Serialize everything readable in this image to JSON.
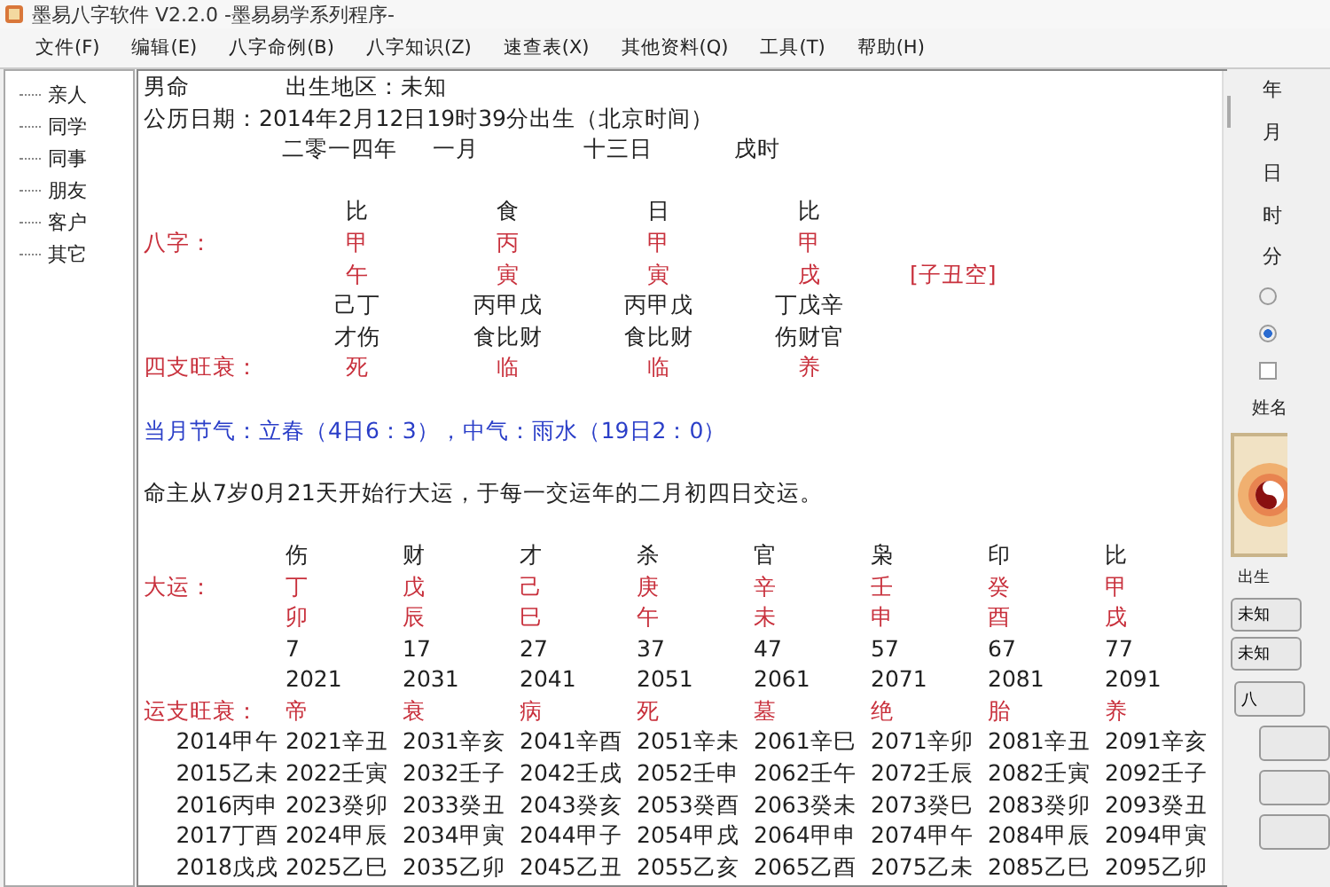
{
  "window": {
    "title": "墨易八字软件 V2.2.0  -墨易易学系列程序-"
  },
  "menu": [
    "文件(F)",
    "编辑(E)",
    "八字命例(B)",
    "八字知识(Z)",
    "速查表(X)",
    "其他资料(Q)",
    "工具(T)",
    "帮助(H)"
  ],
  "sidebar": {
    "items": [
      {
        "label": "亲人",
        "selected": false
      },
      {
        "label": "同学",
        "selected": false
      },
      {
        "label": "同事",
        "selected": false
      },
      {
        "label": "朋友",
        "selected": false
      },
      {
        "label": "客户",
        "selected": false
      },
      {
        "label": "其它",
        "selected": false
      }
    ]
  },
  "chart": {
    "gender": "男命",
    "region": "出生地区：未知",
    "solar_date": "公历日期：2014年2月12日19时39分出生（北京时间）",
    "lunar": [
      "二零一四年",
      "一月",
      "十三日",
      "戌时"
    ],
    "bazi_label": "八字：",
    "state_label": "四支旺衰：",
    "kongwang": "[子丑空]",
    "pillars": [
      {
        "god": "比",
        "stem": "甲",
        "branch": "午",
        "hidden": "己丁",
        "hidden_gods": "才伤",
        "state": "死"
      },
      {
        "god": "食",
        "stem": "丙",
        "branch": "寅",
        "hidden": "丙甲戊",
        "hidden_gods": "食比财",
        "state": "临"
      },
      {
        "god": "日",
        "stem": "甲",
        "branch": "寅",
        "hidden": "丙甲戊",
        "hidden_gods": "食比财",
        "state": "临"
      },
      {
        "god": "比",
        "stem": "甲",
        "branch": "戌",
        "hidden": "丁戊辛",
        "hidden_gods": "伤财官",
        "state": "养"
      }
    ],
    "jieqi": "当月节气：立春（4日6：3），中气：雨水（19日2：0）",
    "start": "命主从7岁0月21天开始行大运，于每一交运年的二月初四日交运。",
    "dayun_label": "大运：",
    "dayun_state_label": "运支旺衰：",
    "dayun": [
      {
        "god": "伤",
        "stem": "丁",
        "branch": "卯",
        "age": "7",
        "year": "2021",
        "state": "帝"
      },
      {
        "god": "财",
        "stem": "戊",
        "branch": "辰",
        "age": "17",
        "year": "2031",
        "state": "衰"
      },
      {
        "god": "才",
        "stem": "己",
        "branch": "巳",
        "age": "27",
        "year": "2041",
        "state": "病"
      },
      {
        "god": "杀",
        "stem": "庚",
        "branch": "午",
        "age": "37",
        "year": "2051",
        "state": "死"
      },
      {
        "god": "官",
        "stem": "辛",
        "branch": "未",
        "age": "47",
        "year": "2061",
        "state": "墓"
      },
      {
        "god": "枭",
        "stem": "壬",
        "branch": "申",
        "age": "57",
        "year": "2071",
        "state": "绝"
      },
      {
        "god": "印",
        "stem": "癸",
        "branch": "酉",
        "age": "67",
        "year": "2081",
        "state": "胎"
      },
      {
        "god": "比",
        "stem": "甲",
        "branch": "戌",
        "age": "77",
        "year": "2091",
        "state": "养"
      }
    ],
    "liunian": [
      [
        "2014甲午",
        "2021辛丑",
        "2031辛亥",
        "2041辛酉",
        "2051辛未",
        "2061辛巳",
        "2071辛卯",
        "2081辛丑",
        "2091辛亥"
      ],
      [
        "2015乙未",
        "2022壬寅",
        "2032壬子",
        "2042壬戌",
        "2052壬申",
        "2062壬午",
        "2072壬辰",
        "2082壬寅",
        "2092壬子"
      ],
      [
        "2016丙申",
        "2023癸卯",
        "2033癸丑",
        "2043癸亥",
        "2053癸酉",
        "2063癸未",
        "2073癸巳",
        "2083癸卯",
        "2093癸丑"
      ],
      [
        "2017丁酉",
        "2024甲辰",
        "2034甲寅",
        "2044甲子",
        "2054甲戌",
        "2064甲申",
        "2074甲午",
        "2084甲辰",
        "2094甲寅"
      ],
      [
        "2018戊戌",
        "2025乙巳",
        "2035乙卯",
        "2045乙丑",
        "2055乙亥",
        "2065乙酉",
        "2075乙未",
        "2085乙巳",
        "2095乙卯"
      ]
    ]
  },
  "side_panel": {
    "fields": [
      "年",
      "月",
      "日",
      "时",
      "分"
    ],
    "radios": [
      {
        "selected": false
      },
      {
        "selected": true
      }
    ],
    "checkbox": {
      "checked": false
    },
    "name_label": "姓名",
    "birth_label": "出生",
    "buttons": [
      {
        "kind": "text",
        "label": "未知"
      },
      {
        "kind": "text",
        "label": "未知"
      },
      {
        "kind": "wide",
        "label": "八"
      },
      {
        "kind": "blank"
      },
      {
        "kind": "blank"
      },
      {
        "kind": "blank"
      }
    ]
  }
}
